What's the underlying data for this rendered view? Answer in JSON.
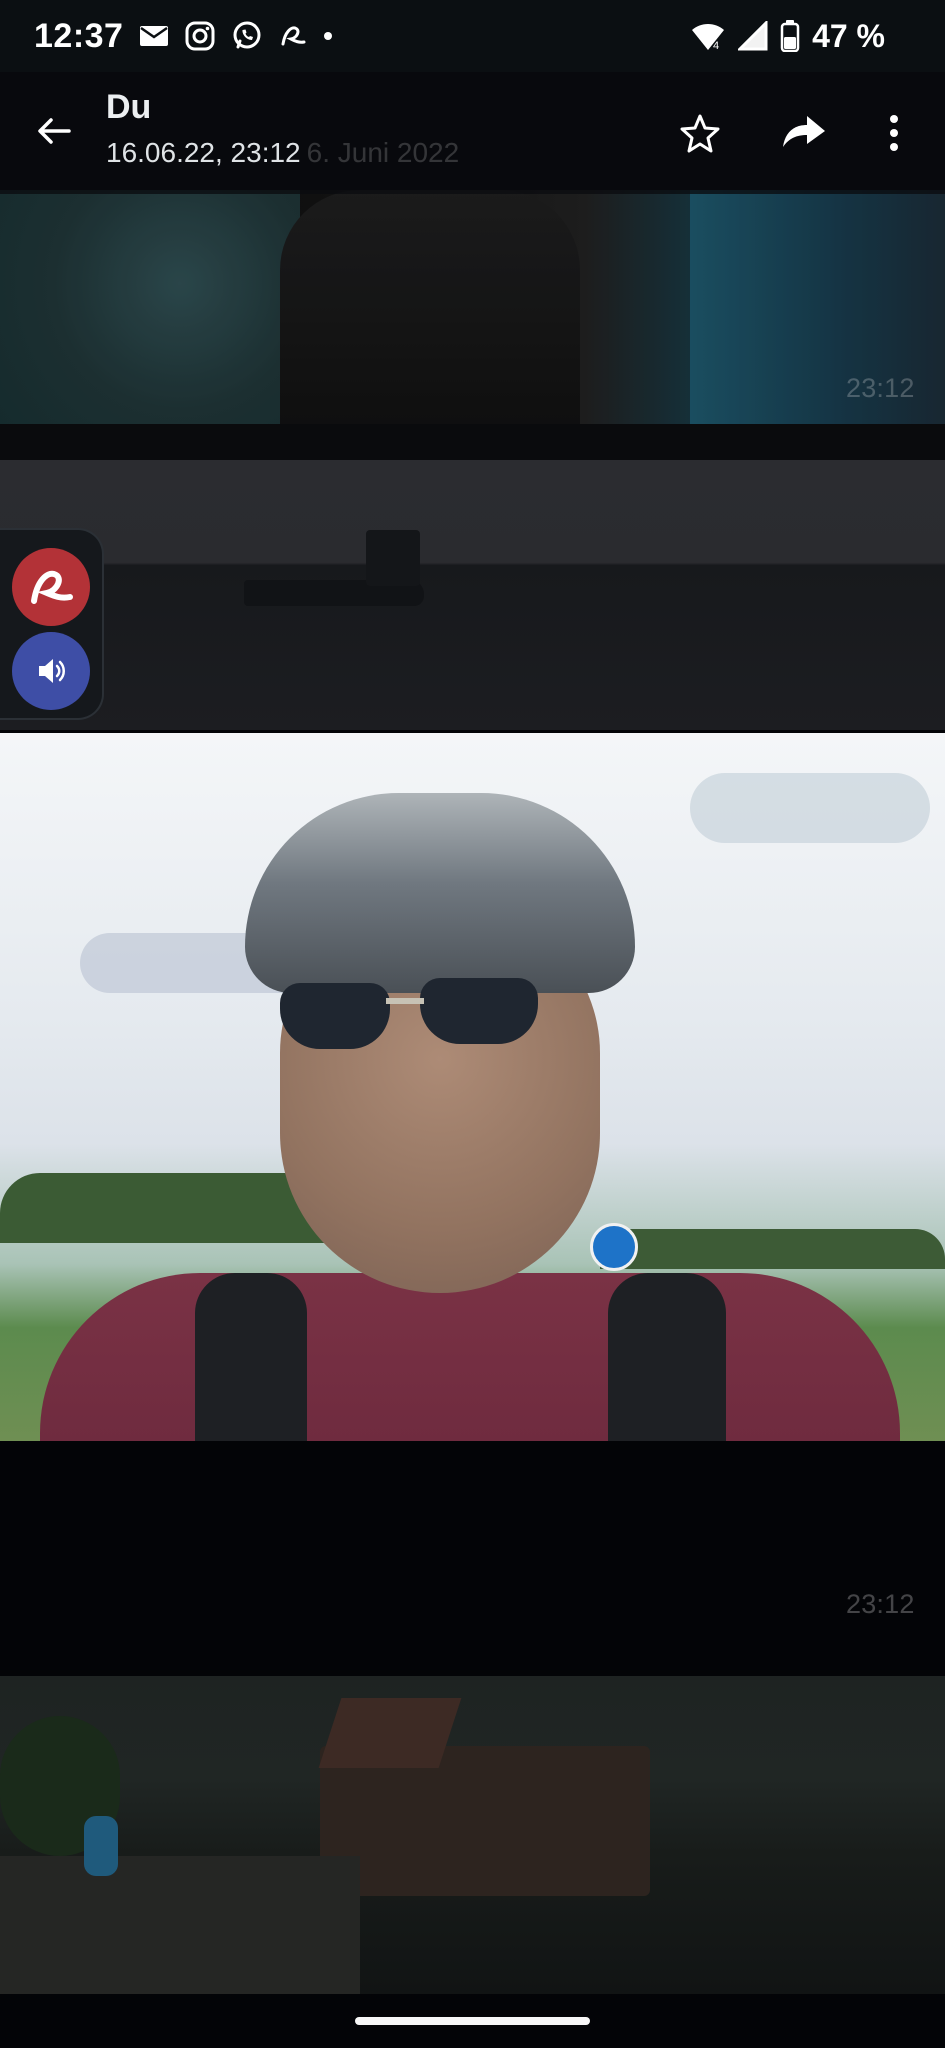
{
  "status_bar": {
    "time": "12:37",
    "battery_percent": "47 %",
    "icons": [
      "mail-icon",
      "instagram-icon",
      "whatsapp-icon",
      "avira-icon",
      "dot-icon",
      "wifi-icon",
      "signal-icon",
      "battery-icon"
    ],
    "wifi_badge": "4"
  },
  "toolbar": {
    "title": "Du",
    "subtitle": "16.06.22, 23:12",
    "subtitle_overlay": "6. Juni 2022"
  },
  "messages": [
    {
      "timestamp": "23:12"
    },
    {
      "timestamp": "23:12"
    }
  ],
  "side_widget": {
    "buttons": [
      "avira-icon",
      "speaker-icon"
    ]
  },
  "colors": {
    "accent_red": "#b33237",
    "accent_blue": "#3e4ea6",
    "background": "#030407"
  }
}
